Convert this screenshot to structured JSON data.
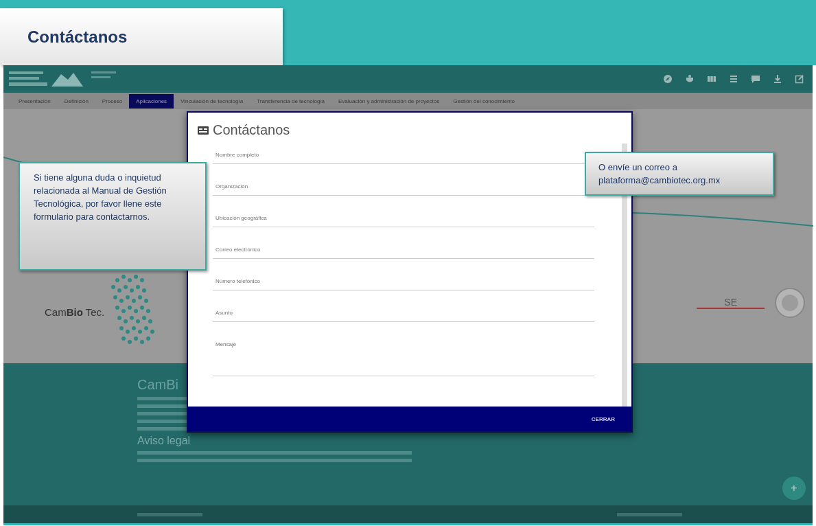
{
  "slide_title": "Contáctanos",
  "site": {
    "nav": [
      {
        "label": "Presentación",
        "selected": false
      },
      {
        "label": "Definición",
        "selected": false
      },
      {
        "label": "Proceso",
        "selected": false
      },
      {
        "label": "Aplicaciones",
        "selected": true
      },
      {
        "label": "Vinculación de tecnología",
        "selected": false
      },
      {
        "label": "Transferencia de tecnología",
        "selected": false
      },
      {
        "label": "Evaluación y administración de proyectos",
        "selected": false
      },
      {
        "label": "Gestión del conocimiento",
        "selected": false
      }
    ],
    "partner_logo": "Cam**Bio** Tec.",
    "government_logo": "SE",
    "footer": {
      "heading": "CamBi",
      "legal_heading": "Aviso legal",
      "fab": "+"
    }
  },
  "modal": {
    "title": "Contáctanos",
    "fields": [
      {
        "placeholder": "Nombre completo",
        "kind": "line"
      },
      {
        "placeholder": "Organización",
        "kind": "line"
      },
      {
        "placeholder": "Ubicación geográfica",
        "kind": "line"
      },
      {
        "placeholder": "Correo electrónico",
        "kind": "line"
      },
      {
        "placeholder": "Número telefónico",
        "kind": "line"
      },
      {
        "placeholder": "Asunto",
        "kind": "line"
      },
      {
        "placeholder": "Mensaje",
        "kind": "area"
      }
    ],
    "close_button": "CERRAR"
  },
  "callouts": {
    "left": "Si tiene alguna duda o inquietud relacionada al Manual de Gestión Tecnológica, por favor llene este formulario para contactarnos.",
    "right": "O envíe un correo a plataforma@cambiotec.org.mx"
  }
}
